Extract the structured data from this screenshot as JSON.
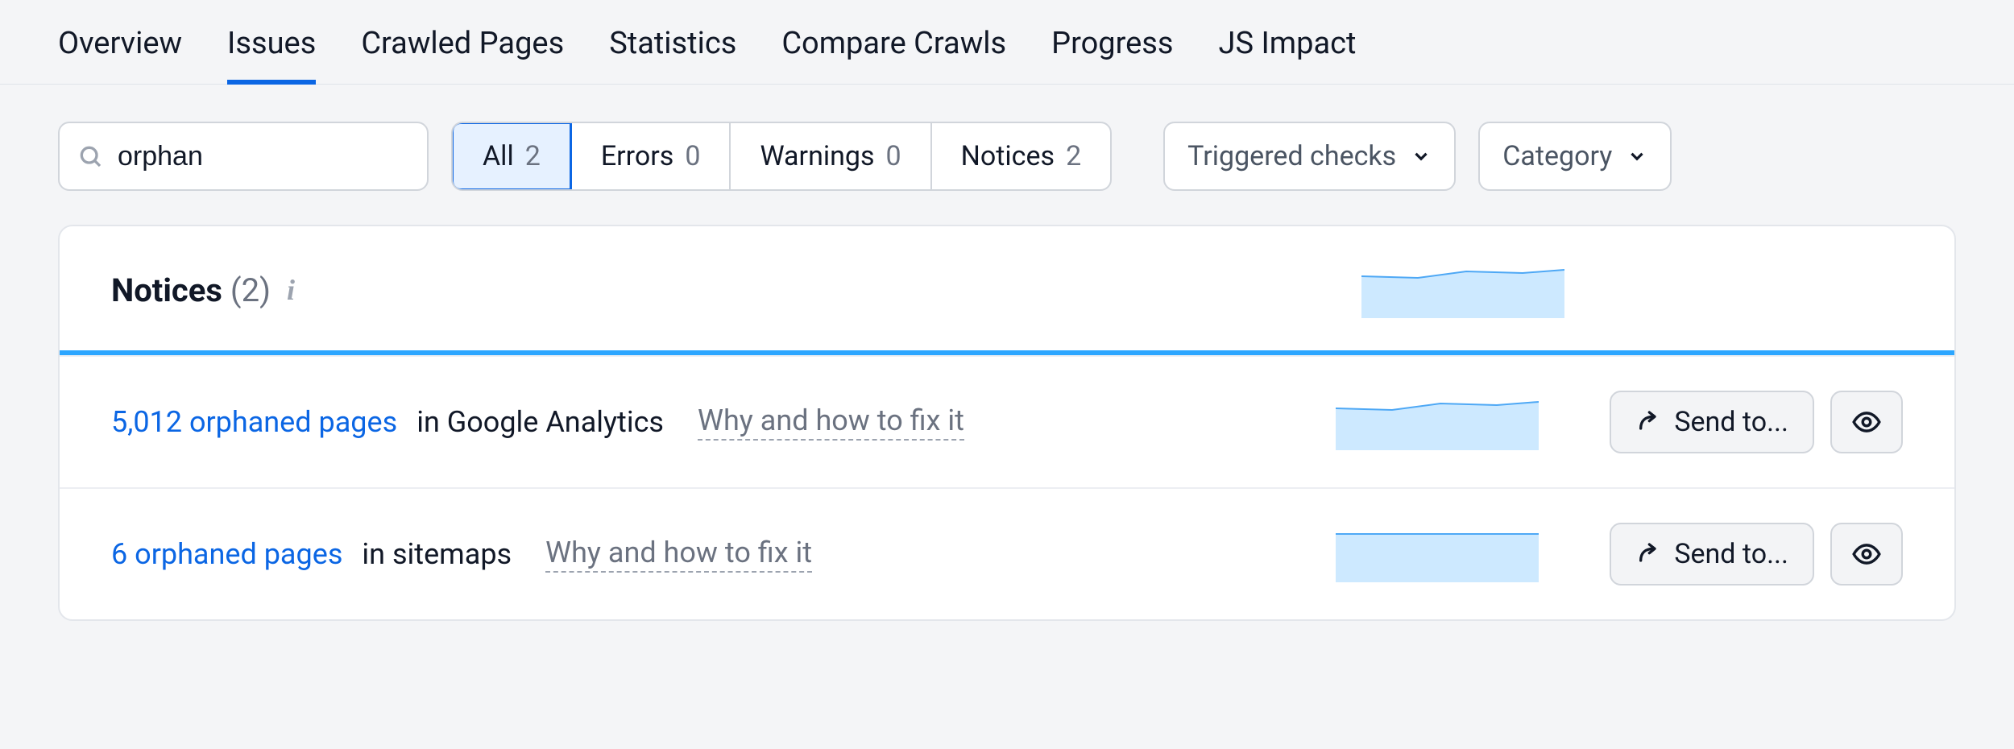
{
  "tabs": [
    "Overview",
    "Issues",
    "Crawled Pages",
    "Statistics",
    "Compare Crawls",
    "Progress",
    "JS Impact"
  ],
  "active_tab_index": 1,
  "search": {
    "value": "orphan"
  },
  "filters": {
    "items": [
      {
        "label": "All",
        "count": "2"
      },
      {
        "label": "Errors",
        "count": "0"
      },
      {
        "label": "Warnings",
        "count": "0"
      },
      {
        "label": "Notices",
        "count": "2"
      }
    ],
    "active_index": 0
  },
  "dropdowns": {
    "triggered": "Triggered checks",
    "category": "Category"
  },
  "panel": {
    "title": "Notices",
    "count": "(2)"
  },
  "rows": [
    {
      "link": "5,012 orphaned pages",
      "desc": " in Google Analytics",
      "whyfix": "Why and how to fix it",
      "send": "Send to..."
    },
    {
      "link": "6 orphaned pages",
      "desc": " in sitemaps",
      "whyfix": "Why and how to fix it",
      "send": "Send to..."
    }
  ]
}
